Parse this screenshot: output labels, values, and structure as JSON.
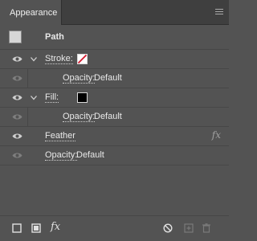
{
  "panel": {
    "tab_label": "Appearance"
  },
  "header": {
    "title": "Path"
  },
  "rows": {
    "stroke": {
      "label": "Stroke:"
    },
    "stroke_opacity": {
      "label": "Opacity:",
      "value": "Default"
    },
    "fill": {
      "label": "Fill:"
    },
    "fill_opacity": {
      "label": "Opacity:",
      "value": "Default"
    },
    "feather": {
      "label": "Feather",
      "fx": "fx"
    },
    "opacity": {
      "label": "Opacity:",
      "value": "Default"
    }
  },
  "bottom": {
    "fx_label": "fx"
  },
  "colors": {
    "panel_bg": "#535353",
    "tabbar_bg": "#3f3f3f",
    "stroke_none_slash": "#d2162c",
    "fill_black": "#000000"
  }
}
